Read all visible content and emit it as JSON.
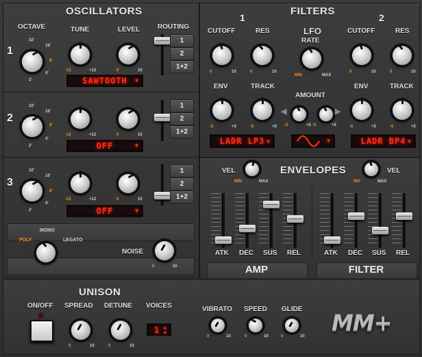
{
  "oscillators": {
    "title": "OSCILLATORS",
    "labels": {
      "octave": "OCTAVE",
      "tune": "TUNE",
      "level": "LEVEL",
      "routing": "ROUTING"
    },
    "octave_ticks": {
      "t32": "32'",
      "t16": "16'",
      "t8": "8'",
      "t4": "4'",
      "t2": "2'"
    },
    "tune_ticks": {
      "min": "-12",
      "max": "+12"
    },
    "level_ticks": {
      "min": "0",
      "max": "10"
    },
    "osc": [
      {
        "number": "1",
        "waveform": "SAWTOOTH",
        "routing": [
          "1",
          "2",
          "1+2"
        ]
      },
      {
        "number": "2",
        "waveform": "OFF",
        "routing": [
          "1",
          "2",
          "1+2"
        ]
      },
      {
        "number": "3",
        "waveform": "OFF",
        "routing": [
          "1",
          "2",
          "1+2"
        ]
      }
    ],
    "mode": {
      "poly": "POLY",
      "mono": "MONO",
      "legato": "LEGATO"
    },
    "noise": {
      "label": "NOISE",
      "min": "0",
      "max": "10"
    }
  },
  "filters": {
    "title": "FILTERS",
    "filter1": {
      "number": "1",
      "cutoff": "CUTOFF",
      "res": "RES",
      "env": "ENV",
      "track": "TRACK",
      "type": "LADR LP3"
    },
    "filter2": {
      "number": "2",
      "cutoff": "CUTOFF",
      "res": "RES",
      "env": "ENV",
      "track": "TRACK",
      "type": "LADR BP4"
    },
    "ticks": {
      "zero": "0",
      "ten": "10",
      "neg5": "-5",
      "pos5": "+5"
    },
    "lfo": {
      "title": "LFO",
      "rate": "RATE",
      "min": "MIN",
      "max": "MAX",
      "amount": "AMOUNT"
    }
  },
  "envelopes": {
    "title": "ENVELOPES",
    "vel": "VEL",
    "min": "MIN",
    "max": "MAX",
    "inv": "INV",
    "stages": [
      "ATK",
      "DEC",
      "SUS",
      "REL"
    ],
    "amp_label": "AMP",
    "filter_label": "FILTER",
    "amp_levels": [
      0.1,
      0.35,
      0.85,
      0.55
    ],
    "filter_levels": [
      0.1,
      0.6,
      0.3,
      0.6
    ]
  },
  "unison": {
    "title": "UNISON",
    "onoff": "ON/OFF",
    "spread": "SPREAD",
    "detune": "DETUNE",
    "voices": "VOICES",
    "voices_value": "1",
    "min": "0",
    "max": "10"
  },
  "global": {
    "vibrato": "VIBRATO",
    "speed": "SPEED",
    "glide": "GLIDE",
    "min": "0",
    "max": "10",
    "logo": "MM+"
  }
}
